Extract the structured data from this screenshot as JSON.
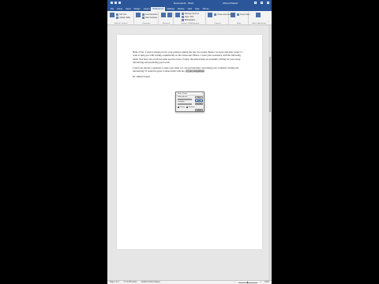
{
  "window": {
    "doc_title": "Document1 - Word",
    "user_name": "Ahmed Saeed"
  },
  "tabs": [
    "File",
    "Home",
    "Insert",
    "Design",
    "Layout",
    "References",
    "Mailings",
    "Review",
    "View",
    "Help",
    "Tell me"
  ],
  "ribbon": {
    "groups": [
      {
        "label": "Table of Contents",
        "buttons": [
          "Table of Contents",
          "Add Text",
          "Update Table"
        ]
      },
      {
        "label": "Footnotes",
        "buttons": [
          "Insert Footnote",
          "Insert Endnote",
          "Next Footnote"
        ]
      },
      {
        "label": "Research",
        "buttons": [
          "Search",
          "Researcher"
        ]
      },
      {
        "label": "Citations & Bibliography",
        "buttons": [
          "Insert Citation",
          "Manage Sources",
          "Style: APA",
          "Bibliography"
        ]
      },
      {
        "label": "Captions",
        "buttons": [
          "Insert Caption",
          "Cross-reference"
        ]
      },
      {
        "label": "Index",
        "buttons": [
          "Mark Entry",
          "Insert Index"
        ]
      },
      {
        "label": "Table of Authorities",
        "buttons": [
          "Mark Citation"
        ]
      }
    ]
  },
  "document": {
    "paragraphs": [
      "Hello. First, I want to thank you for your patience during the last two weeks. Before we leave and after week 5 I want to help you with writing academically in the classroom. Hence, I want your assistance with the following items. You have also received some practice notes. Follow the instructions on academic writing for your essay, referencing and producing good work.",
      "Could you ask me a question or state your issue so I can provide help concerning your academic writing and referencing? It would be great to share them with me.",
      "Cheers, Dr. Ahmed Saeed"
    ],
    "highlight": "to your assignment",
    "signature": "Dr. Ahmed Saeed"
  },
  "dialog": {
    "title": "Mark Citation",
    "labels": [
      "Selected text:",
      "Short citation:",
      "Long citation:",
      "Category:"
    ],
    "options": [
      "Cases",
      "Statutes"
    ],
    "buttons": [
      "Next",
      "Mark",
      "Cancel",
      "Mark All",
      "Category..."
    ]
  },
  "status": {
    "page": "Page 1 of 1",
    "words": "77 of 155 words",
    "language": "English (United States)",
    "zoom": "100%"
  }
}
